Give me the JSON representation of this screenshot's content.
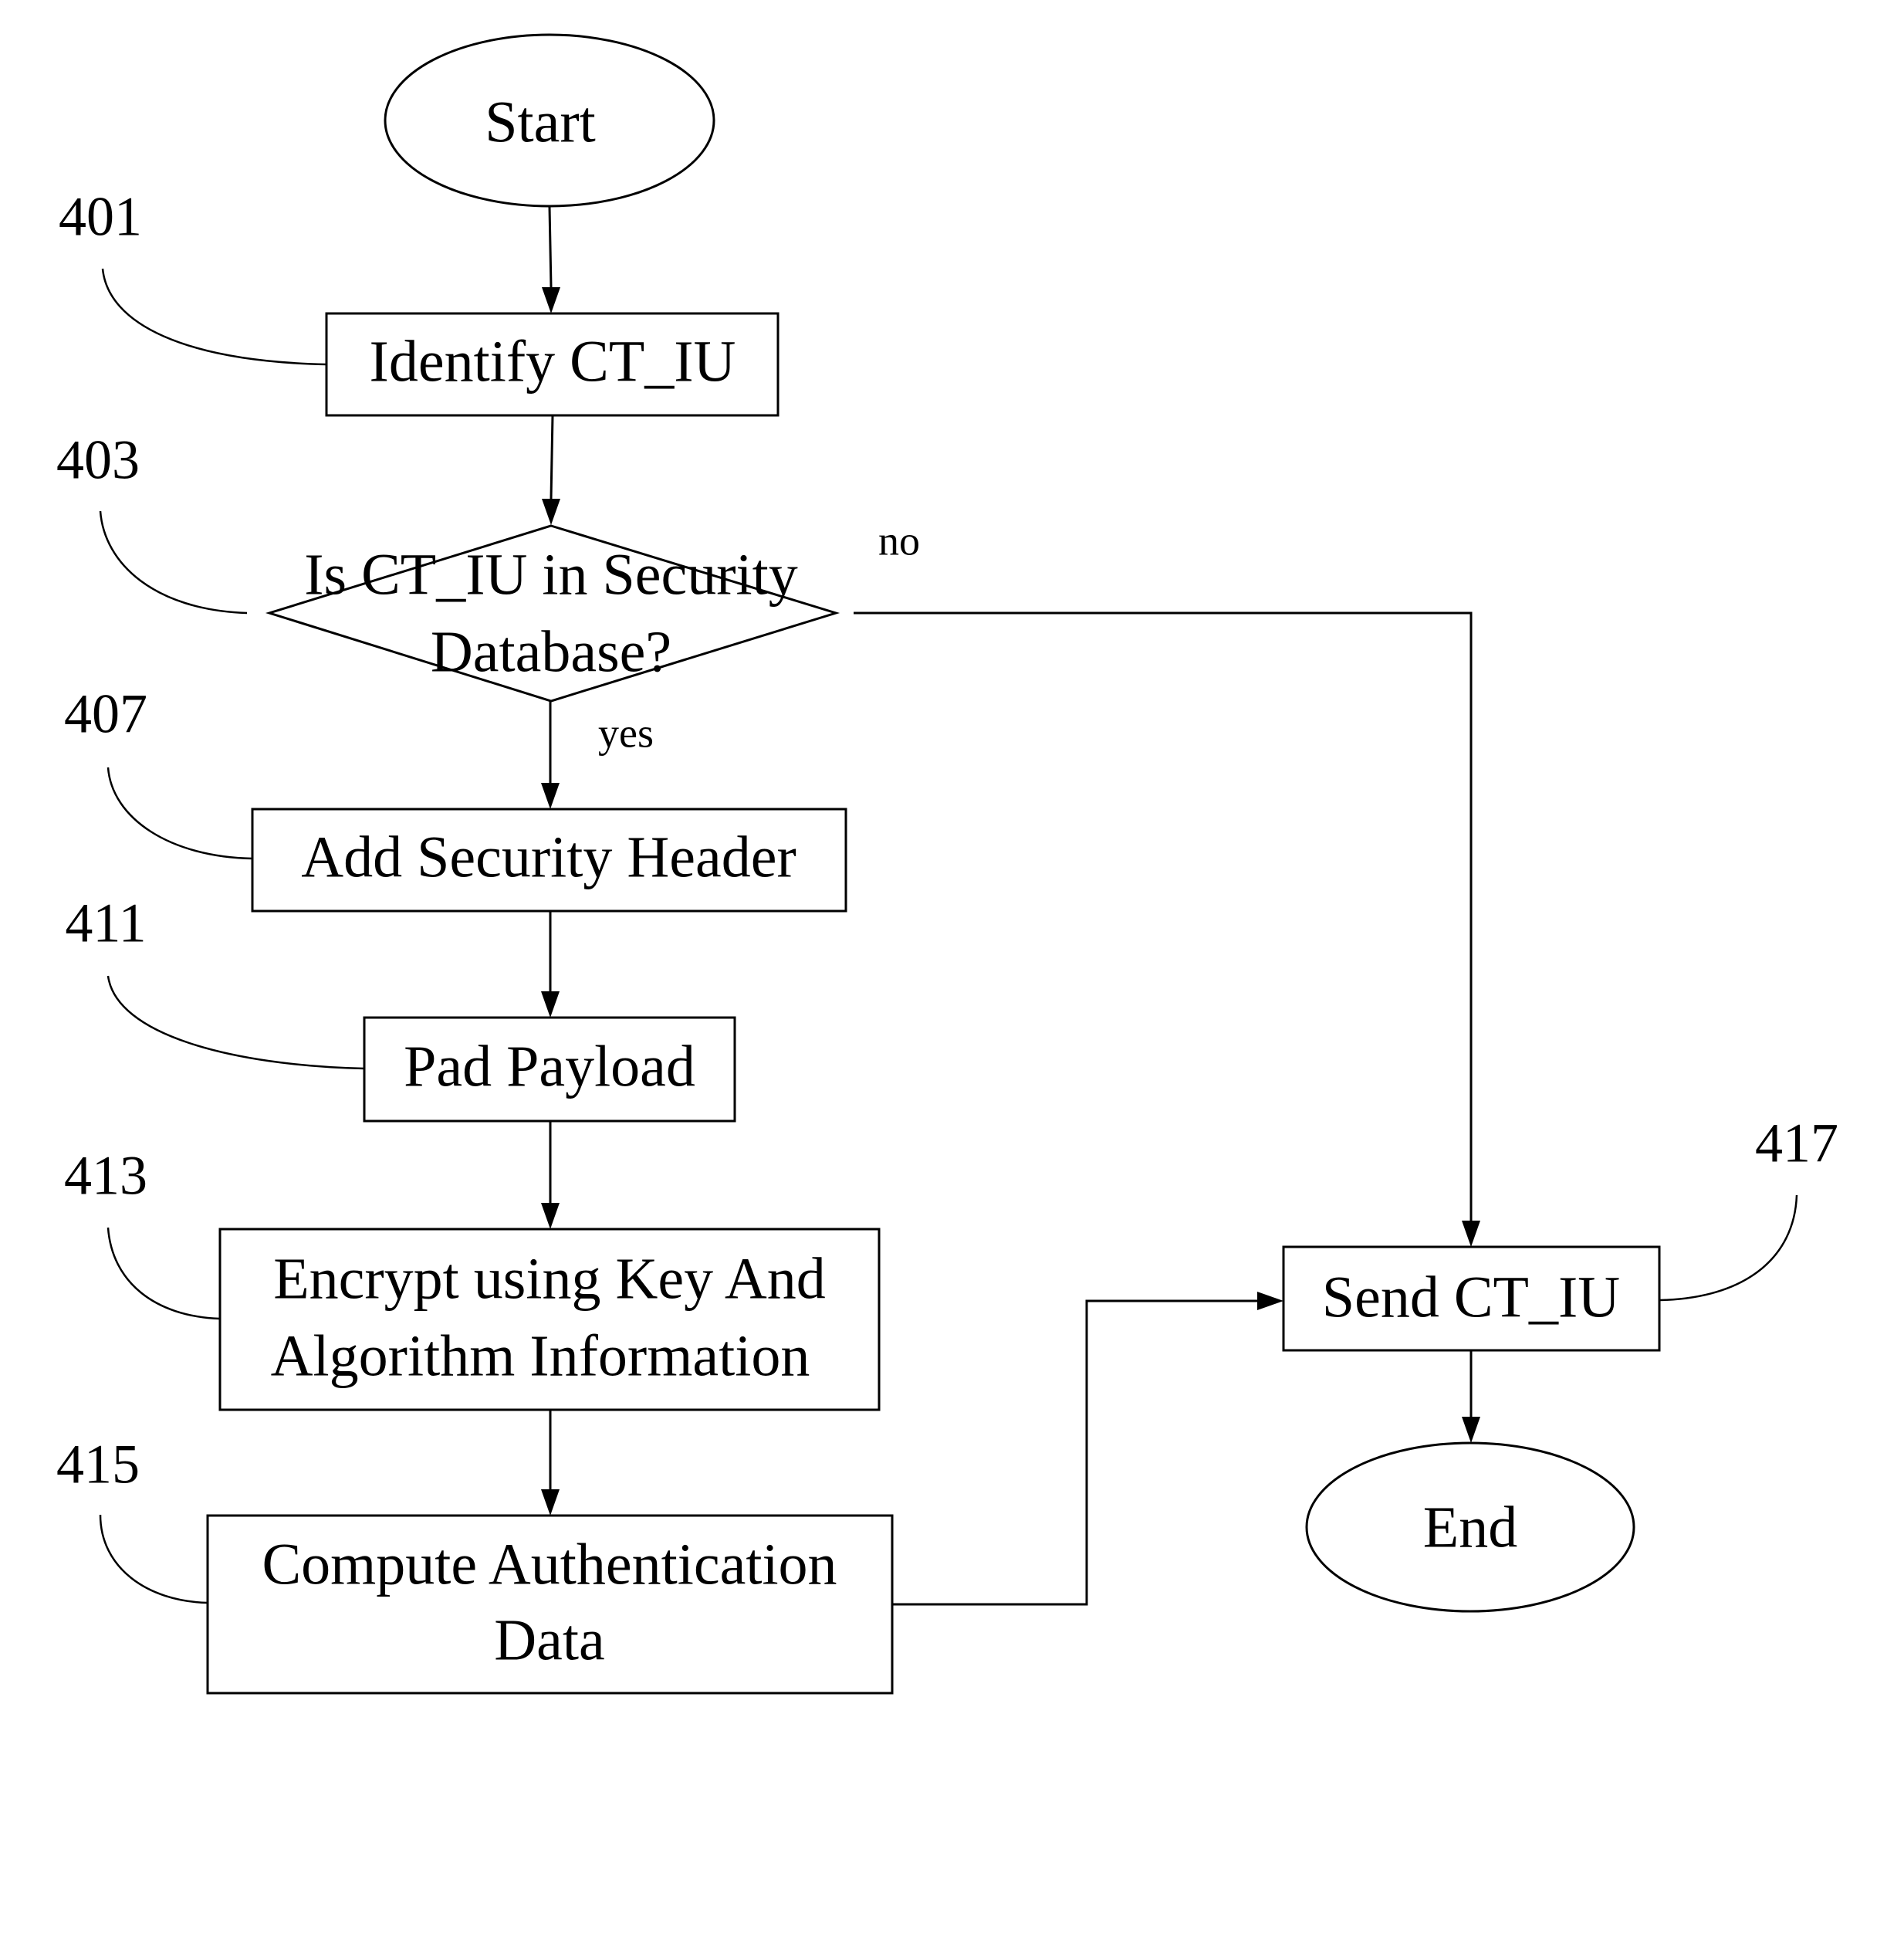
{
  "diagram": {
    "type": "flowchart",
    "nodes": {
      "start": {
        "label": "Start",
        "shape": "ellipse"
      },
      "identify": {
        "label": "Identify CT_IU",
        "ref": "401",
        "shape": "rect"
      },
      "decision": {
        "line1": "Is CT_IU in Security",
        "line2": "Database?",
        "ref": "403",
        "shape": "diamond"
      },
      "add_header": {
        "label": "Add Security Header",
        "ref": "407",
        "shape": "rect"
      },
      "pad": {
        "label": "Pad Payload",
        "ref": "411",
        "shape": "rect"
      },
      "encrypt": {
        "line1": "Encrypt using Key And",
        "line2": "Algorithm Information",
        "ref": "413",
        "shape": "rect"
      },
      "compute": {
        "line1": "Compute Authentication",
        "line2": "Data",
        "ref": "415",
        "shape": "rect"
      },
      "send": {
        "label": "Send CT_IU",
        "ref": "417",
        "shape": "rect"
      },
      "end": {
        "label": "End",
        "shape": "ellipse"
      }
    },
    "edges": {
      "yes_label": "yes",
      "no_label": "no",
      "list": [
        {
          "from": "start",
          "to": "identify"
        },
        {
          "from": "identify",
          "to": "decision"
        },
        {
          "from": "decision",
          "to": "add_header",
          "label": "yes"
        },
        {
          "from": "decision",
          "to": "send",
          "label": "no"
        },
        {
          "from": "add_header",
          "to": "pad"
        },
        {
          "from": "pad",
          "to": "encrypt"
        },
        {
          "from": "encrypt",
          "to": "compute"
        },
        {
          "from": "compute",
          "to": "send"
        },
        {
          "from": "send",
          "to": "end"
        }
      ]
    }
  }
}
